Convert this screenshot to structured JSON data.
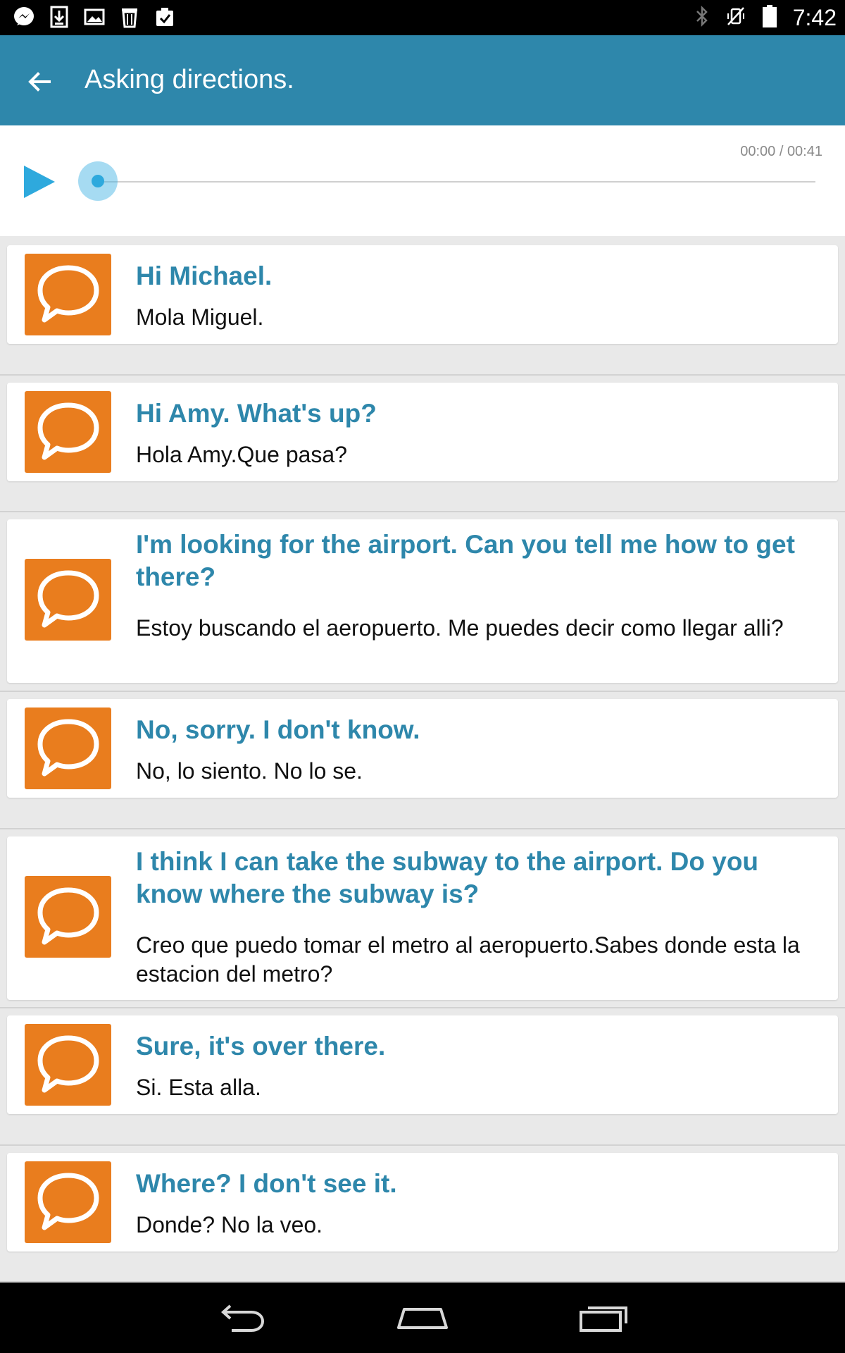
{
  "status_bar": {
    "time": "7:42",
    "left_icons": [
      "messenger-icon",
      "download-icon",
      "image-icon",
      "trash-icon",
      "clipboard-check-icon"
    ],
    "right_icons": [
      "bluetooth-icon",
      "vibrate-off-icon",
      "battery-icon"
    ]
  },
  "app_bar": {
    "title": "Asking directions.",
    "color": "#2e87ab"
  },
  "player": {
    "time_readout": "00:00 / 00:41",
    "progress": 0
  },
  "dialogue": [
    {
      "english": "Hi Michael.",
      "spanish": "Mola Miguel."
    },
    {
      "english": "Hi Amy. What's up?",
      "spanish": "Hola Amy.Que pasa?"
    },
    {
      "english": "I'm looking for the airport. Can you tell me how to get there?",
      "spanish": "Estoy buscando el aeropuerto. Me puedes decir como llegar alli?"
    },
    {
      "english": "No, sorry. I don't know.",
      "spanish": "No, lo siento. No lo se."
    },
    {
      "english": "I think I can take the subway to the airport. Do you know where the subway is?",
      "spanish": "Creo que puedo tomar el metro al aeropuerto.Sabes donde esta la estacion del metro?"
    },
    {
      "english": "Sure, it's over there.",
      "spanish": "Si. Esta alla."
    },
    {
      "english": "Where? I don't see it.",
      "spanish": "Donde? No la veo."
    }
  ],
  "colors": {
    "accent": "#2e87ab",
    "bubble": "#e97d1e",
    "seek": "#2ea9dd"
  },
  "nav_bar": [
    "back-icon",
    "home-icon",
    "recents-icon"
  ]
}
